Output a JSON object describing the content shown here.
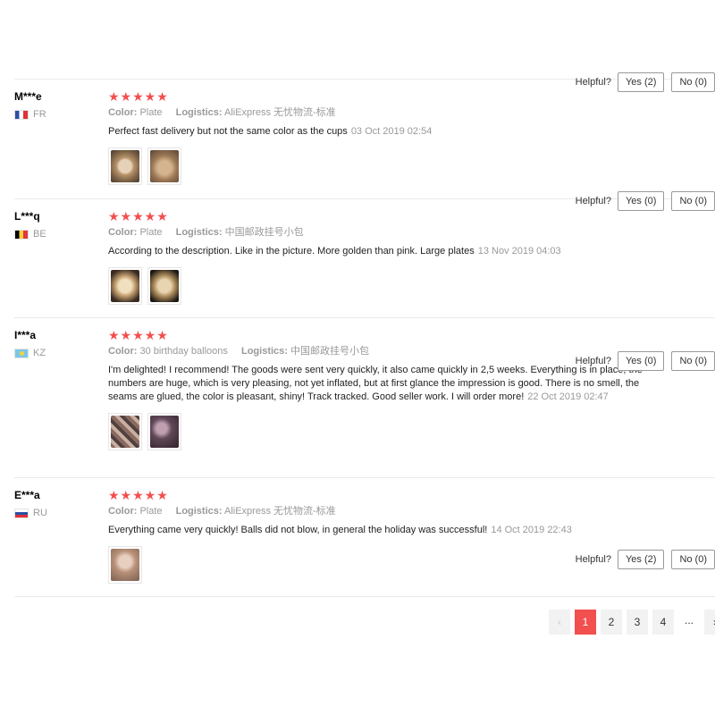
{
  "colors": {
    "star": "#f24f4f",
    "active_page": "#f24f4f"
  },
  "reviews": [
    {
      "user": "M***e",
      "country": "FR",
      "flag": "flag-fr-icon",
      "stars": "★★★★★",
      "attrs": [
        {
          "key": "Color:",
          "value": "Plate"
        },
        {
          "key": "Logistics:",
          "value": "AliExpress 无忧物流-标准"
        }
      ],
      "text": "Perfect fast delivery but not the same color as the cups",
      "date": "03 Oct 2019 02:54",
      "helpful": "Helpful?",
      "yes": "Yes (2)",
      "no": "No (0)"
    },
    {
      "user": "L***q",
      "country": "BE",
      "flag": "flag-be-icon",
      "stars": "★★★★★",
      "attrs": [
        {
          "key": "Color:",
          "value": "Plate"
        },
        {
          "key": "Logistics:",
          "value": "中国邮政挂号小包"
        }
      ],
      "text": "According to the description. Like in the picture. More golden than pink. Large plates",
      "date": "13 Nov 2019 04:03",
      "helpful": "Helpful?",
      "yes": "Yes (0)",
      "no": "No (0)"
    },
    {
      "user": "I***a",
      "country": "KZ",
      "flag": "flag-kz-icon",
      "stars": "★★★★★",
      "attrs": [
        {
          "key": "Color:",
          "value": "30 birthday balloons"
        },
        {
          "key": "Logistics:",
          "value": "中国邮政挂号小包"
        }
      ],
      "text": "I'm delighted! I recommend! The goods were sent very quickly, it also came quickly in 2,5 weeks. Everything is in place, the numbers are huge, which is very pleasing, not yet inflated, but at first glance the impression is good. There is no smell, the seams are glued, the color is pleasant, shiny! Track tracked. Good seller work. I will order more!",
      "date": "22 Oct 2019 02:47",
      "helpful": "Helpful?",
      "yes": "Yes (0)",
      "no": "No (0)"
    },
    {
      "user": "E***a",
      "country": "RU",
      "flag": "flag-ru-icon",
      "stars": "★★★★★",
      "attrs": [
        {
          "key": "Color:",
          "value": "Plate"
        },
        {
          "key": "Logistics:",
          "value": "AliExpress 无忧物流-标准"
        }
      ],
      "text": "Everything came very quickly! Balls did not blow, in general the holiday was successful!",
      "date": "14 Oct 2019 22:43",
      "helpful": "Helpful?",
      "yes": "Yes (2)",
      "no": "No (0)"
    }
  ],
  "pagination": {
    "prev": "‹",
    "pages": [
      "1",
      "2",
      "3",
      "4"
    ],
    "ellipsis": "...",
    "next": "›",
    "current": "1"
  }
}
